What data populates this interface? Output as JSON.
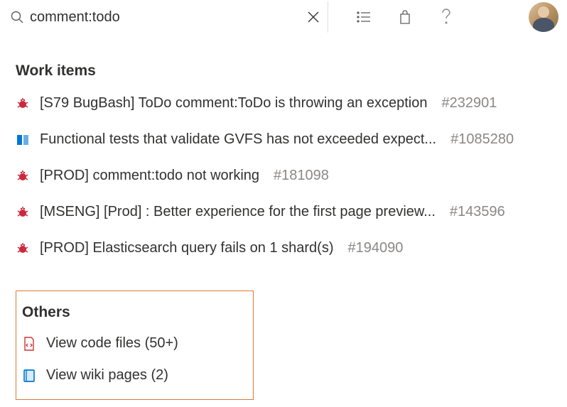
{
  "search": {
    "value": "comment:todo",
    "placeholder": ""
  },
  "sections": {
    "work_items": {
      "heading": "Work items",
      "items": [
        {
          "icon": "bug",
          "title": "[S79 BugBash] ToDo comment:ToDo is throwing an exception",
          "id": "#232901"
        },
        {
          "icon": "spec",
          "title": "Functional tests that validate GVFS has not exceeded expect...",
          "id": "#1085280"
        },
        {
          "icon": "bug",
          "title": "[PROD] comment:todo not working",
          "id": "#181098"
        },
        {
          "icon": "bug",
          "title": "[MSENG] [Prod] : Better experience for the first page preview...",
          "id": "#143596"
        },
        {
          "icon": "bug",
          "title": "[PROD] Elasticsearch query fails on 1 shard(s)",
          "id": "#194090"
        }
      ]
    },
    "others": {
      "heading": "Others",
      "items": [
        {
          "icon": "code",
          "label": "View code files (50+)"
        },
        {
          "icon": "wiki",
          "label": "View wiki pages (2)"
        }
      ]
    }
  },
  "colors": {
    "bug": "#cc293d",
    "spec": "#0078d4",
    "code": "#d13438",
    "wiki": "#0078d4",
    "highlight_border": "#d87a3a"
  }
}
